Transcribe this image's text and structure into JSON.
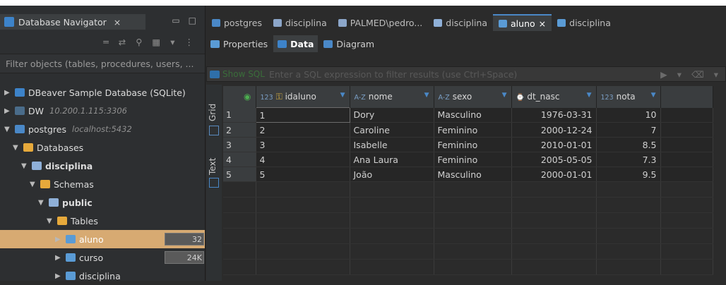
{
  "navigator": {
    "tab_label": "Database Navigator",
    "close": "×",
    "min": "▭",
    "max": "□",
    "filter_placeholder": "Filter objects (tables, procedures, users, ...",
    "tree": [
      {
        "label": "DBeaver Sample Database (SQLite)",
        "sub": "",
        "twisty": "▶",
        "icon": "sqlite-db-icon",
        "color": "#3d83c9",
        "level": 0,
        "bold": false
      },
      {
        "label": "DW",
        "sub": "10.200.1.115:3306",
        "twisty": "▶",
        "icon": "mysql-db-icon",
        "color": "#4a6c8a",
        "level": 0,
        "bold": false
      },
      {
        "label": "postgres",
        "sub": "localhost:5432",
        "twisty": "▼",
        "icon": "postgres-db-icon",
        "color": "#4a88c7",
        "level": 0,
        "bold": false
      },
      {
        "label": "Databases",
        "sub": "",
        "twisty": "▼",
        "icon": "folder-icon",
        "color": "#e6a93b",
        "level": 1,
        "bold": false
      },
      {
        "label": "disciplina",
        "sub": "",
        "twisty": "▼",
        "icon": "database-icon",
        "color": "#8fb0d8",
        "level": 2,
        "bold": true
      },
      {
        "label": "Schemas",
        "sub": "",
        "twisty": "▼",
        "icon": "schemas-folder-icon",
        "color": "#e6a93b",
        "level": 3,
        "bold": false
      },
      {
        "label": "public",
        "sub": "",
        "twisty": "▼",
        "icon": "schema-icon",
        "color": "#8fb0d8",
        "level": 4,
        "bold": true
      },
      {
        "label": "Tables",
        "sub": "",
        "twisty": "▼",
        "icon": "tables-folder-icon",
        "color": "#e6a93b",
        "level": 5,
        "bold": false
      },
      {
        "label": "aluno",
        "sub": "",
        "twisty": "▶",
        "icon": "table-icon",
        "color": "#5a9bd5",
        "level": 6,
        "bold": false,
        "selected": true,
        "size": "32"
      },
      {
        "label": "curso",
        "sub": "",
        "twisty": "▶",
        "icon": "table-icon",
        "color": "#5a9bd5",
        "level": 6,
        "bold": false,
        "size": "24K"
      },
      {
        "label": "disciplina",
        "sub": "",
        "twisty": "▶",
        "icon": "table-icon",
        "color": "#5a9bd5",
        "level": 6,
        "bold": false
      }
    ]
  },
  "editor": {
    "tabs": [
      {
        "label": "postgres",
        "icon": "connection-icon",
        "color": "#4a88c7",
        "active": false
      },
      {
        "label": "disciplina",
        "icon": "sql-editor-icon",
        "color": "#8ca6c9",
        "active": false
      },
      {
        "label": "PALMED\\pedro...",
        "icon": "sql-editor-icon",
        "color": "#8ca6c9",
        "active": false
      },
      {
        "label": "disciplina",
        "icon": "database-icon",
        "color": "#8fb0d8",
        "active": false
      },
      {
        "label": "aluno",
        "icon": "table-icon",
        "color": "#5a9bd5",
        "active": true,
        "close": "×"
      },
      {
        "label": "disciplina",
        "icon": "table-icon",
        "color": "#5a9bd5",
        "active": false
      }
    ],
    "subtabs": [
      {
        "label": "Properties",
        "icon": "properties-icon",
        "color": "#5a9bd5",
        "active": false
      },
      {
        "label": "Data",
        "icon": "data-icon",
        "color": "#3d83c9",
        "active": true
      },
      {
        "label": "Diagram",
        "icon": "diagram-icon",
        "color": "#4a88c7",
        "active": false
      }
    ],
    "sql": {
      "show_sql": "Show SQL",
      "placeholder": "Enter a SQL expression to filter results (use Ctrl+Space)"
    },
    "vertical_tabs": {
      "grid": "Grid",
      "text": "Text"
    },
    "grid": {
      "columns": [
        {
          "type": "123",
          "name": "idaluno",
          "key": true
        },
        {
          "type": "A-Z",
          "name": "nome",
          "key": false
        },
        {
          "type": "A-Z",
          "name": "sexo",
          "key": false
        },
        {
          "type": "⌚",
          "name": "dt_nasc",
          "key": false
        },
        {
          "type": "123",
          "name": "nota",
          "key": false
        }
      ],
      "rows": [
        {
          "rn": "1",
          "idaluno": "1",
          "nome": "Dory",
          "sexo": "Masculino",
          "dt_nasc": "1976-03-31",
          "nota": "10"
        },
        {
          "rn": "2",
          "idaluno": "2",
          "nome": "Caroline",
          "sexo": "Feminino",
          "dt_nasc": "2000-12-24",
          "nota": "7"
        },
        {
          "rn": "3",
          "idaluno": "3",
          "nome": "Isabelle",
          "sexo": "Feminino",
          "dt_nasc": "2010-01-01",
          "nota": "8.5"
        },
        {
          "rn": "4",
          "idaluno": "4",
          "nome": "Ana Laura",
          "sexo": "Feminino",
          "dt_nasc": "2005-05-05",
          "nota": "7.3"
        },
        {
          "rn": "5",
          "idaluno": "5",
          "nome": "João",
          "sexo": "Masculino",
          "dt_nasc": "2000-01-01",
          "nota": "9.5"
        }
      ]
    }
  }
}
